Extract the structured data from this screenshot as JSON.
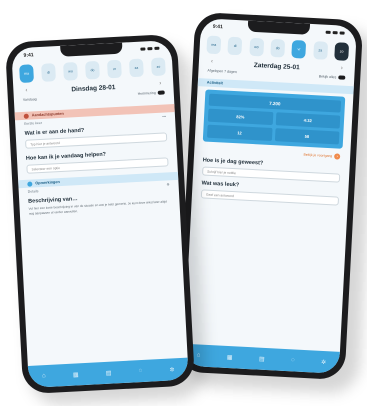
{
  "colors": {
    "accent": "#3ea7df",
    "accent_dark": "#2f93cb",
    "frame": "#1c1c1e",
    "alert_band": "#f2c3b7",
    "info_band": "#cfe8f7",
    "orange": "#f08a4b"
  },
  "back_phone": {
    "status_time": "9:41",
    "days": [
      "ma",
      "di",
      "wo",
      "do",
      "vr",
      "za",
      "zo"
    ],
    "title": "Zaterdag 25-01",
    "sub_left": "Afgelopen 7 dagen",
    "sub_right": "Bekijk alles",
    "section": "Activiteit",
    "metric_top": "7.200",
    "metrics": [
      "82%",
      "4:32",
      "12",
      "58"
    ],
    "orange_note": "Bekijk je voortgang",
    "q1": "Hoe is je dag geweest?",
    "p1": "Schrijf hier je notitie",
    "q2": "Wat was leuk?",
    "p2": "Geef een antwoord"
  },
  "front_phone": {
    "status_time": "9:41",
    "days": [
      "ma",
      "di",
      "wo",
      "do",
      "vr",
      "za",
      "zo"
    ],
    "title": "Dinsdag 28-01",
    "sub_left": "Vandaag",
    "sub_right": "Herinnering",
    "alert": "Aandachtspunten",
    "alert_note": "Eerste keer",
    "q1": "Wat is er aan de hand?",
    "p1": "Typ hier je antwoord",
    "q2": "Hoe kan ik je vandaag helpen?",
    "p2": "Selecteer een optie",
    "info": "Opmerkingen",
    "info_note": "Details",
    "heading": "Beschrijving van…",
    "para": "Vul hier een korte beschrijving in van de situatie en wat je hebt gemerkt. Je kunt deze tekst later altijd nog aanpassen of verder aanvullen."
  },
  "tabs": [
    "home-icon",
    "calendar-icon",
    "chart-icon",
    "chat-icon",
    "settings-icon"
  ]
}
